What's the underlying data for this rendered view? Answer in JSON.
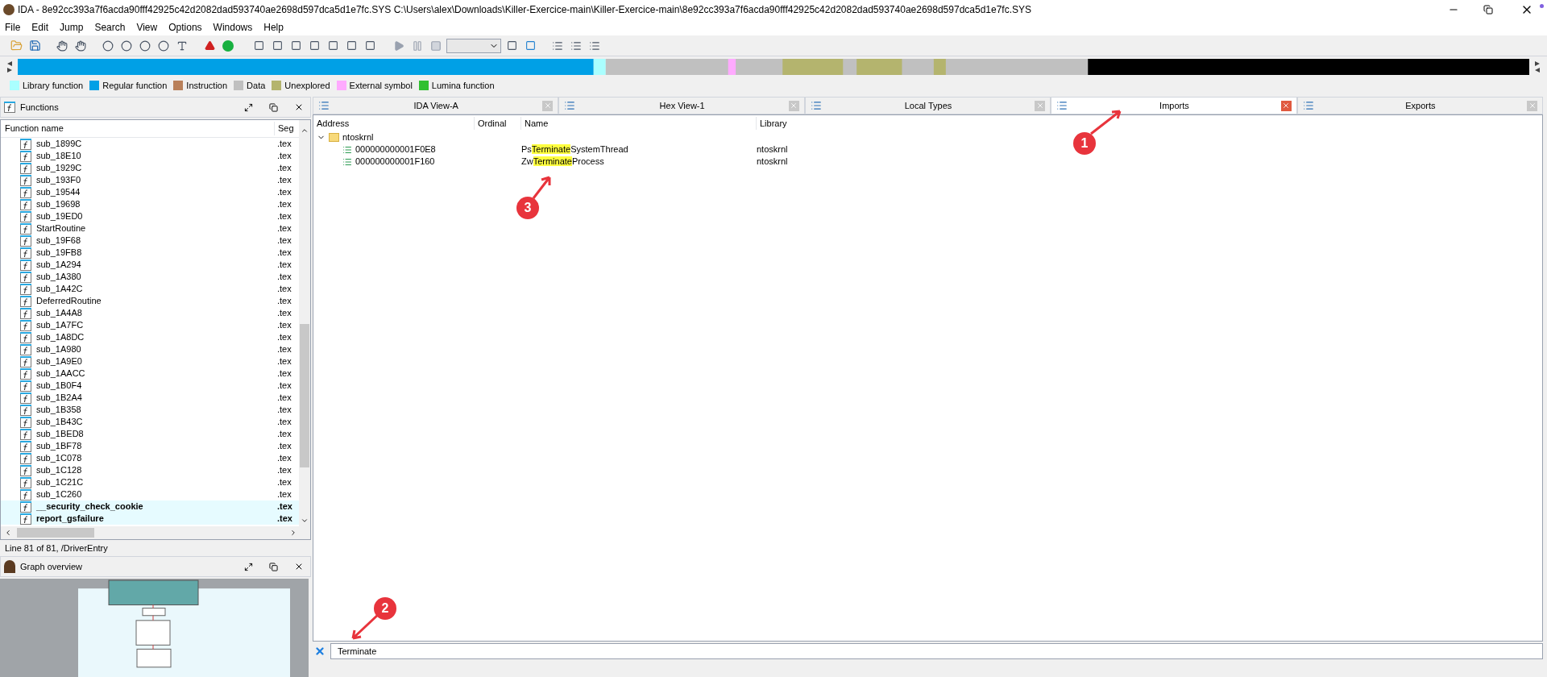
{
  "window": {
    "title": "IDA - 8e92cc393a7f6acda90fff42925c42d2082dad593740ae2698d597dca5d1e7fc.SYS C:\\Users\\alex\\Downloads\\Killer-Exercice-main\\Killer-Exercice-main\\8e92cc393a7f6acda90fff42925c42d2082dad593740ae2698d597dca5d1e7fc.SYS"
  },
  "menu": [
    "File",
    "Edit",
    "Jump",
    "Search",
    "View",
    "Options",
    "Windows",
    "Help"
  ],
  "legend": [
    {
      "label": "Library function",
      "color": "#aaffff"
    },
    {
      "label": "Regular function",
      "color": "#00a0e6"
    },
    {
      "label": "Instruction",
      "color": "#b9805a"
    },
    {
      "label": "Data",
      "color": "#c0c0c0"
    },
    {
      "label": "Unexplored",
      "color": "#b4b46e"
    },
    {
      "label": "External symbol",
      "color": "#ffaaff"
    },
    {
      "label": "Lumina function",
      "color": "#30c030"
    }
  ],
  "functions_panel": {
    "title": "Functions",
    "columns": [
      "Function name",
      "Seg"
    ],
    "rows": [
      {
        "name": "sub_1899C",
        "seg": ".tex",
        "kind": "regular"
      },
      {
        "name": "sub_18E10",
        "seg": ".tex",
        "kind": "regular"
      },
      {
        "name": "sub_1929C",
        "seg": ".tex",
        "kind": "regular"
      },
      {
        "name": "sub_193F0",
        "seg": ".tex",
        "kind": "regular"
      },
      {
        "name": "sub_19544",
        "seg": ".tex",
        "kind": "regular"
      },
      {
        "name": "sub_19698",
        "seg": ".tex",
        "kind": "regular"
      },
      {
        "name": "sub_19ED0",
        "seg": ".tex",
        "kind": "regular"
      },
      {
        "name": "StartRoutine",
        "seg": ".tex",
        "kind": "regular"
      },
      {
        "name": "sub_19F68",
        "seg": ".tex",
        "kind": "regular"
      },
      {
        "name": "sub_19FB8",
        "seg": ".tex",
        "kind": "regular"
      },
      {
        "name": "sub_1A294",
        "seg": ".tex",
        "kind": "regular"
      },
      {
        "name": "sub_1A380",
        "seg": ".tex",
        "kind": "regular"
      },
      {
        "name": "sub_1A42C",
        "seg": ".tex",
        "kind": "regular"
      },
      {
        "name": "DeferredRoutine",
        "seg": ".tex",
        "kind": "regular"
      },
      {
        "name": "sub_1A4A8",
        "seg": ".tex",
        "kind": "regular"
      },
      {
        "name": "sub_1A7FC",
        "seg": ".tex",
        "kind": "regular"
      },
      {
        "name": "sub_1A8DC",
        "seg": ".tex",
        "kind": "regular"
      },
      {
        "name": "sub_1A980",
        "seg": ".tex",
        "kind": "regular"
      },
      {
        "name": "sub_1A9E0",
        "seg": ".tex",
        "kind": "regular"
      },
      {
        "name": "sub_1AACC",
        "seg": ".tex",
        "kind": "regular"
      },
      {
        "name": "sub_1B0F4",
        "seg": ".tex",
        "kind": "regular"
      },
      {
        "name": "sub_1B2A4",
        "seg": ".tex",
        "kind": "regular"
      },
      {
        "name": "sub_1B358",
        "seg": ".tex",
        "kind": "regular"
      },
      {
        "name": "sub_1B43C",
        "seg": ".tex",
        "kind": "regular"
      },
      {
        "name": "sub_1BED8",
        "seg": ".tex",
        "kind": "regular"
      },
      {
        "name": "sub_1BF78",
        "seg": ".tex",
        "kind": "regular"
      },
      {
        "name": "sub_1C078",
        "seg": ".tex",
        "kind": "regular"
      },
      {
        "name": "sub_1C128",
        "seg": ".tex",
        "kind": "regular"
      },
      {
        "name": "sub_1C21C",
        "seg": ".tex",
        "kind": "regular"
      },
      {
        "name": "sub_1C260",
        "seg": ".tex",
        "kind": "regular"
      },
      {
        "name": "__security_check_cookie",
        "seg": ".tex",
        "kind": "library"
      },
      {
        "name": "report_gsfailure",
        "seg": ".tex",
        "kind": "library"
      }
    ],
    "status": "Line 81 of 81, /DriverEntry"
  },
  "graph_panel": {
    "title": "Graph overview"
  },
  "tabs": [
    {
      "label": "IDA View-A",
      "selected": false
    },
    {
      "label": "Hex View-1",
      "selected": false
    },
    {
      "label": "Local Types",
      "selected": false
    },
    {
      "label": "Imports",
      "selected": true
    },
    {
      "label": "Exports",
      "selected": false
    }
  ],
  "imports": {
    "columns": [
      "Address",
      "Ordinal",
      "Name",
      "Library"
    ],
    "group": {
      "name": "ntoskrnl",
      "expanded": true
    },
    "rows": [
      {
        "address": "000000000001F0E8",
        "name_before": "Ps",
        "name_match": "Terminate",
        "name_after": "SystemThread",
        "library": "ntoskrnl"
      },
      {
        "address": "000000000001F160",
        "name_before": "Zw",
        "name_match": "Terminate",
        "name_after": "Process",
        "library": "ntoskrnl"
      }
    ]
  },
  "filter": {
    "value": "Terminate"
  },
  "annotations": [
    "1",
    "2",
    "3"
  ]
}
